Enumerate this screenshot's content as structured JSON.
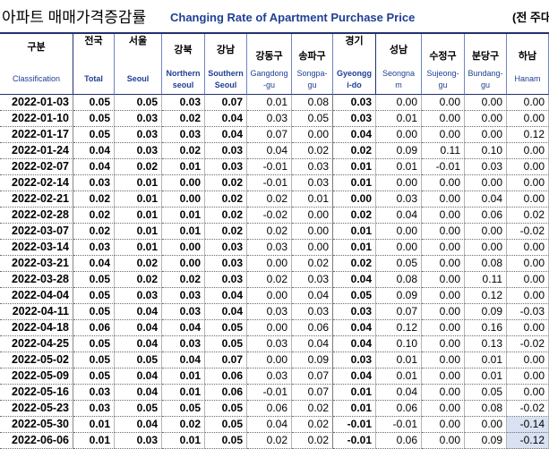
{
  "colors": {
    "title_blue": "#1f3f93",
    "header_line": "#23306e",
    "highlight": "#d9e2f3"
  },
  "chart_data": {
    "type": "table",
    "title": "아파트 매매가격증감률",
    "subtitle": "Changing Rate of Apartment Purchase Price",
    "unit_note": "(전 주대",
    "row_header": {
      "korean": "구분",
      "english": [
        "Classification"
      ]
    },
    "columns": [
      {
        "korean": "전국",
        "english": [
          "Total"
        ]
      },
      {
        "korean": "서울",
        "english": [
          "Seoul"
        ]
      },
      {
        "korean": "강북",
        "english": [
          "Northern",
          "seoul"
        ]
      },
      {
        "korean": "강남",
        "english": [
          "Southern",
          "Seoul"
        ]
      },
      {
        "korean": "강동구",
        "english": [
          "Gangdong",
          "-gu"
        ]
      },
      {
        "korean": "송파구",
        "english": [
          "Songpa-",
          "gu"
        ]
      },
      {
        "korean": "경기",
        "english": [
          "Gyeongg",
          "i-do"
        ]
      },
      {
        "korean": "성남",
        "english": [
          "Seongna",
          "m"
        ]
      },
      {
        "korean": "수정구",
        "english": [
          "Sujeong-",
          "gu"
        ]
      },
      {
        "korean": "분당구",
        "english": [
          "Bundang-",
          "gu"
        ]
      },
      {
        "korean": "하남",
        "english": [
          "Hanam"
        ]
      }
    ],
    "rows": [
      {
        "date": "2022-01-03",
        "values": [
          0.05,
          0.05,
          0.03,
          0.07,
          0.01,
          0.08,
          0.03,
          0.0,
          0.0,
          0.0,
          0.0
        ]
      },
      {
        "date": "2022-01-10",
        "values": [
          0.05,
          0.03,
          0.02,
          0.04,
          0.03,
          0.05,
          0.03,
          0.01,
          0.0,
          0.0,
          0.0
        ]
      },
      {
        "date": "2022-01-17",
        "values": [
          0.05,
          0.03,
          0.03,
          0.04,
          0.07,
          0.0,
          0.04,
          0.0,
          0.0,
          0.0,
          0.12
        ]
      },
      {
        "date": "2022-01-24",
        "values": [
          0.04,
          0.03,
          0.02,
          0.03,
          0.04,
          0.02,
          0.02,
          0.09,
          0.11,
          0.1,
          0.0
        ]
      },
      {
        "date": "2022-02-07",
        "values": [
          0.04,
          0.02,
          0.01,
          0.03,
          -0.01,
          0.03,
          0.01,
          0.01,
          -0.01,
          0.03,
          0.0
        ]
      },
      {
        "date": "2022-02-14",
        "values": [
          0.03,
          0.01,
          0.0,
          0.02,
          -0.01,
          0.03,
          0.01,
          0.0,
          0.0,
          0.0,
          0.0
        ]
      },
      {
        "date": "2022-02-21",
        "values": [
          0.02,
          0.01,
          0.0,
          0.02,
          0.02,
          0.01,
          0.0,
          0.03,
          0.0,
          0.04,
          0.0
        ]
      },
      {
        "date": "2022-02-28",
        "values": [
          0.02,
          0.01,
          0.01,
          0.02,
          -0.02,
          0.0,
          0.02,
          0.04,
          0.0,
          0.06,
          0.02
        ]
      },
      {
        "date": "2022-03-07",
        "values": [
          0.02,
          0.01,
          0.01,
          0.02,
          0.02,
          0.0,
          0.01,
          0.0,
          0.0,
          0.0,
          -0.02
        ]
      },
      {
        "date": "2022-03-14",
        "values": [
          0.03,
          0.01,
          0.0,
          0.03,
          0.03,
          0.0,
          0.01,
          0.0,
          0.0,
          0.0,
          0.0
        ]
      },
      {
        "date": "2022-03-21",
        "values": [
          0.04,
          0.02,
          0.0,
          0.03,
          0.0,
          0.02,
          0.02,
          0.05,
          0.0,
          0.08,
          0.0
        ]
      },
      {
        "date": "2022-03-28",
        "values": [
          0.05,
          0.02,
          0.02,
          0.03,
          0.02,
          0.03,
          0.04,
          0.08,
          0.0,
          0.11,
          0.0
        ]
      },
      {
        "date": "2022-04-04",
        "values": [
          0.05,
          0.03,
          0.03,
          0.04,
          0.0,
          0.04,
          0.05,
          0.09,
          0.0,
          0.12,
          0.0
        ]
      },
      {
        "date": "2022-04-11",
        "values": [
          0.05,
          0.04,
          0.03,
          0.04,
          0.03,
          0.03,
          0.03,
          0.07,
          0.0,
          0.09,
          -0.03
        ]
      },
      {
        "date": "2022-04-18",
        "values": [
          0.06,
          0.04,
          0.04,
          0.05,
          0.0,
          0.06,
          0.04,
          0.12,
          0.0,
          0.16,
          0.0
        ]
      },
      {
        "date": "2022-04-25",
        "values": [
          0.05,
          0.04,
          0.03,
          0.05,
          0.03,
          0.04,
          0.04,
          0.1,
          0.0,
          0.13,
          -0.02
        ]
      },
      {
        "date": "2022-05-02",
        "values": [
          0.05,
          0.05,
          0.04,
          0.07,
          0.0,
          0.09,
          0.03,
          0.01,
          0.0,
          0.01,
          0.0
        ]
      },
      {
        "date": "2022-05-09",
        "values": [
          0.05,
          0.04,
          0.01,
          0.06,
          0.03,
          0.07,
          0.04,
          0.01,
          0.0,
          0.01,
          0.0
        ]
      },
      {
        "date": "2022-05-16",
        "values": [
          0.03,
          0.04,
          0.01,
          0.06,
          -0.01,
          0.07,
          0.01,
          0.04,
          0.0,
          0.05,
          0.0
        ]
      },
      {
        "date": "2022-05-23",
        "values": [
          0.03,
          0.05,
          0.05,
          0.05,
          0.06,
          0.02,
          0.01,
          0.06,
          0.0,
          0.08,
          -0.02
        ]
      },
      {
        "date": "2022-05-30",
        "values": [
          0.01,
          0.04,
          0.02,
          0.05,
          0.04,
          0.02,
          -0.01,
          -0.01,
          0.0,
          0.0,
          -0.14
        ]
      },
      {
        "date": "2022-06-06",
        "values": [
          0.01,
          0.03,
          0.01,
          0.05,
          0.02,
          0.02,
          -0.01,
          0.06,
          0.0,
          0.09,
          -0.12
        ]
      }
    ]
  }
}
